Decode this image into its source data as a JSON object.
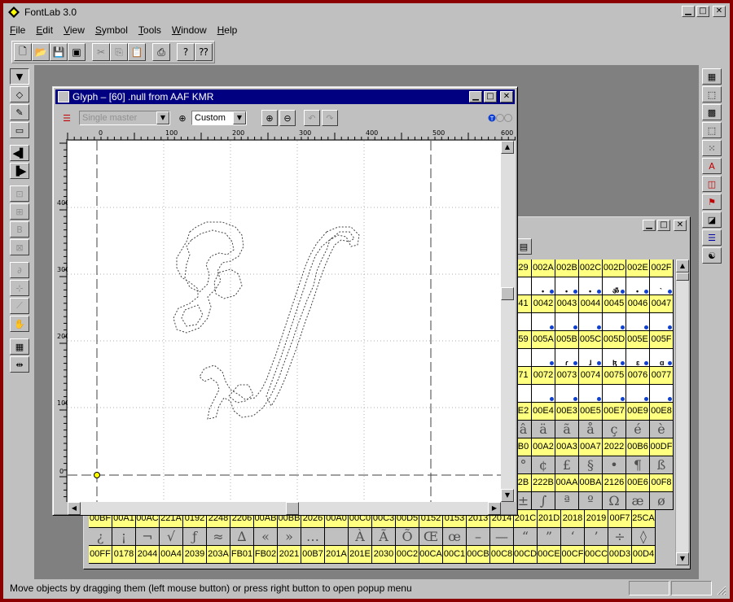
{
  "app": {
    "title": "FontLab 3.0"
  },
  "menu": {
    "items": [
      {
        "label": "File",
        "ul": "F",
        "rest": "ile"
      },
      {
        "label": "Edit",
        "ul": "E",
        "rest": "dit"
      },
      {
        "label": "View",
        "ul": "V",
        "rest": "iew"
      },
      {
        "label": "Symbol",
        "ul": "S",
        "rest": "ymbol"
      },
      {
        "label": "Tools",
        "ul": "T",
        "rest": "ools"
      },
      {
        "label": "Window",
        "ul": "W",
        "rest": "indow"
      },
      {
        "label": "Help",
        "ul": "H",
        "rest": "elp"
      }
    ]
  },
  "toolbar": {
    "buttons": [
      {
        "name": "new-icon",
        "glyph": "🗋"
      },
      {
        "name": "open-icon",
        "glyph": "📂"
      },
      {
        "name": "save-icon",
        "glyph": "💾"
      },
      {
        "name": "save-all-icon",
        "glyph": "▣"
      },
      {
        "name": "cut-icon",
        "glyph": "✂"
      },
      {
        "name": "copy-icon",
        "glyph": "⎘"
      },
      {
        "name": "paste-icon",
        "glyph": "📋"
      },
      {
        "name": "print-icon",
        "glyph": "⎙"
      },
      {
        "name": "help-icon",
        "glyph": "?"
      },
      {
        "name": "context-help-icon",
        "glyph": "⁇"
      }
    ]
  },
  "glyph_window": {
    "title": "Glyph – [60] .null from AAF KMR",
    "master_select": "Single master",
    "zoom_select": "Custom",
    "ruler_top": [
      "0",
      "100",
      "200",
      "300",
      "400",
      "500",
      "600"
    ],
    "ruler_left": [
      "400",
      "300",
      "200",
      "100",
      "0"
    ]
  },
  "font_window": {
    "rows": [
      {
        "type": "hdr",
        "cells": [
          "29",
          "002A",
          "002B",
          "002C",
          "002D",
          "002E",
          "002F"
        ]
      },
      {
        "type": "glyph",
        "cells": [
          "",
          "•",
          "•",
          "•",
          "ॐ",
          "•",
          "`"
        ],
        "dots": [
          false,
          true,
          true,
          true,
          true,
          true,
          true
        ]
      },
      {
        "type": "hdr",
        "cells": [
          "41",
          "0042",
          "0043",
          "0044",
          "0045",
          "0046",
          "0047"
        ]
      },
      {
        "type": "glyph",
        "cells": [
          "",
          "",
          "",
          "",
          "",
          "",
          ""
        ],
        "dots": [
          false,
          true,
          true,
          true,
          true,
          true,
          true
        ]
      },
      {
        "type": "hdr",
        "cells": [
          "59",
          "005A",
          "005B",
          "005C",
          "005D",
          "005E",
          "005F"
        ]
      },
      {
        "type": "glyph",
        "cells": [
          "",
          "",
          "ɾ",
          "ɺ",
          "ɮ",
          "ɛ",
          "ɑ"
        ],
        "dots": [
          false,
          true,
          true,
          true,
          true,
          true,
          true
        ]
      },
      {
        "type": "hdr",
        "cells": [
          "71",
          "0072",
          "0073",
          "0074",
          "0075",
          "0076",
          "0077"
        ]
      },
      {
        "type": "glyph",
        "cells": [
          "",
          "",
          "",
          "",
          "",
          "",
          ""
        ],
        "dots": [
          false,
          true,
          true,
          true,
          true,
          true,
          true
        ]
      },
      {
        "type": "hdr",
        "cells": [
          "E2",
          "00E4",
          "00E3",
          "00E5",
          "00E7",
          "00E9",
          "00E8"
        ]
      },
      {
        "type": "grey",
        "cells": [
          "â",
          "ä",
          "ã",
          "å",
          "ç",
          "é",
          "è"
        ]
      },
      {
        "type": "hdr",
        "cells": [
          "B0",
          "00A2",
          "00A3",
          "00A7",
          "2022",
          "00B6",
          "00DF"
        ]
      },
      {
        "type": "grey",
        "cells": [
          "°",
          "¢",
          "£",
          "§",
          "•",
          "¶",
          "ß"
        ]
      },
      {
        "type": "hdr",
        "cells": [
          "2B",
          "222B",
          "00AA",
          "00BA",
          "2126",
          "00E6",
          "00F8"
        ]
      },
      {
        "type": "grey",
        "cells": [
          "±",
          "∫",
          "ª",
          "º",
          "Ω",
          "æ",
          "ø"
        ]
      }
    ],
    "wide_rows": [
      {
        "type": "hdr",
        "cells": [
          "00BF",
          "00A1",
          "00AC",
          "221A",
          "0192",
          "2248",
          "2206",
          "00AB",
          "00BB",
          "2026",
          "00A0",
          "00C0",
          "00C3",
          "00D5",
          "0152",
          "0153",
          "2013",
          "2014",
          "201C",
          "201D",
          "2018",
          "2019",
          "00F7",
          "25CA"
        ]
      },
      {
        "type": "grey",
        "cells": [
          "¿",
          "¡",
          "¬",
          "√",
          "ƒ",
          "≈",
          "∆",
          "«",
          "»",
          "…",
          "",
          "À",
          "Ã",
          "Õ",
          "Œ",
          "œ",
          "–",
          "—",
          "“",
          "”",
          "‘",
          "’",
          "÷",
          "◊"
        ]
      },
      {
        "type": "hdr",
        "cells": [
          "00FF",
          "0178",
          "2044",
          "00A4",
          "2039",
          "203A",
          "FB01",
          "FB02",
          "2021",
          "00B7",
          "201A",
          "201E",
          "2030",
          "00C2",
          "00CA",
          "00C1",
          "00CB",
          "00C8",
          "00CD",
          "00CE",
          "00CF",
          "00CC",
          "00D3",
          "00D4"
        ]
      }
    ]
  },
  "status": {
    "text": "Move objects by dragging them (left mouse button) or press right button to open popup menu"
  }
}
